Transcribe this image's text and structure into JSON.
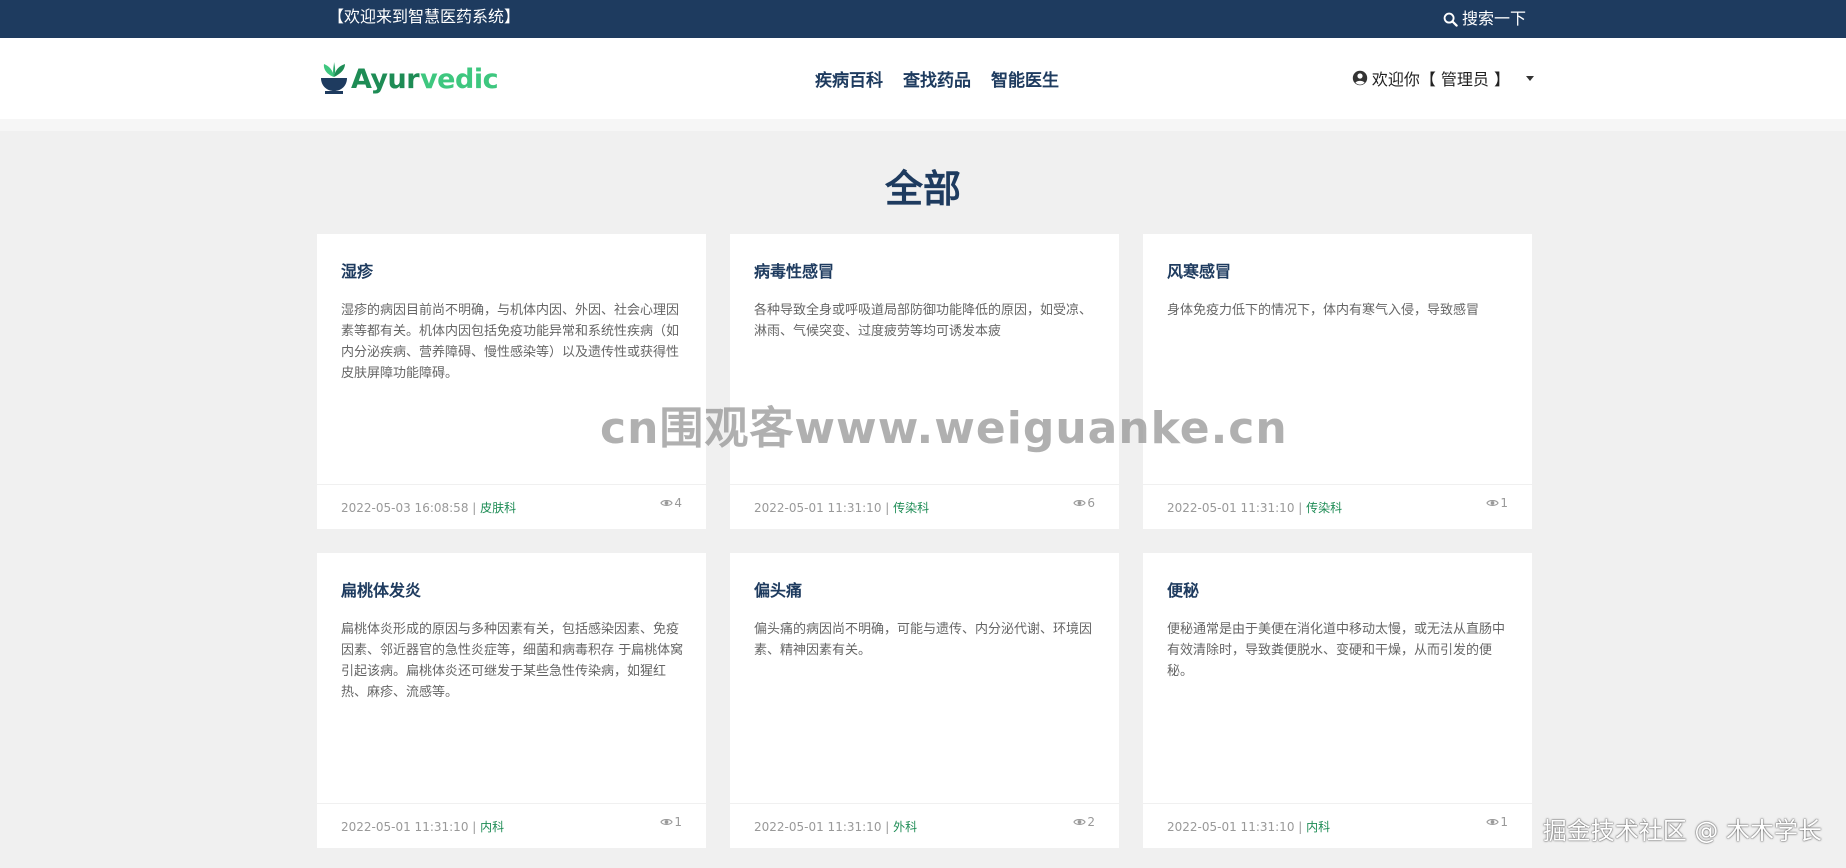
{
  "topbar": {
    "welcome": "【欢迎来到智慧医药系统】",
    "search_label": "搜索一下"
  },
  "header": {
    "logo": {
      "text_1": "Ayur",
      "text_2": "vedic"
    },
    "nav": [
      "疾病百科",
      "查找药品",
      "智能医生"
    ],
    "user": {
      "greeting": "欢迎你【 管理员 】"
    }
  },
  "section_title": "全部",
  "cards": [
    {
      "title": "湿疹",
      "desc": "湿疹的病因目前尚不明确，与机体内因、外因、社会心理因素等都有关。机体内因包括免疫功能异常和系统性疾病（如内分泌疾病、营养障碍、慢性感染等）以及遗传性或获得性 皮肤屏障功能障碍。",
      "date": "2022-05-03 16:08:58",
      "category": "皮肤科",
      "views": "4"
    },
    {
      "title": "病毒性感冒",
      "desc": "各种导致全身或呼吸道局部防御功能降低的原因，如受凉、淋雨、气候突变、过度疲劳等均可诱发本疲",
      "date": "2022-05-01 11:31:10",
      "category": "传染科",
      "views": "6"
    },
    {
      "title": "风寒感冒",
      "desc": "身体免疫力低下的情况下，体内有寒气入侵，导致感冒",
      "date": "2022-05-01 11:31:10",
      "category": "传染科",
      "views": "1"
    },
    {
      "title": "扁桃体发炎",
      "desc": "扁桃体炎形成的原因与多种因素有关，包括感染因素、免疫因素、邻近器官的急性炎症等，细菌和病毒积存 于扁桃体窝引起该病。扁桃体炎还可继发于某些急性传染病，如猩红热、麻疹、流感等。",
      "date": "2022-05-01 11:31:10",
      "category": "内科",
      "views": "1"
    },
    {
      "title": "偏头痛",
      "desc": "偏头痛的病因尚不明确，可能与遗传、内分泌代谢、环境因素、精神因素有关。",
      "date": "2022-05-01 11:31:10",
      "category": "外科",
      "views": "2"
    },
    {
      "title": "便秘",
      "desc": "便秘通常是由于美便在消化道中移动太慢，或无法从直肠中有效清除时，导致粪便脱水、变硬和干燥，从而引发的便秘。",
      "date": "2022-05-01 11:31:10",
      "category": "内科",
      "views": "1"
    }
  ],
  "overlay": {
    "watermark": "cn围观客www.weiguanke.cn",
    "credit": "掘金技术社区 @ 木木学长"
  },
  "colors": {
    "navy": "#1e3b5f",
    "green": "#1e8c55",
    "light_green": "#3ec77f",
    "background": "#f0f0f0"
  }
}
